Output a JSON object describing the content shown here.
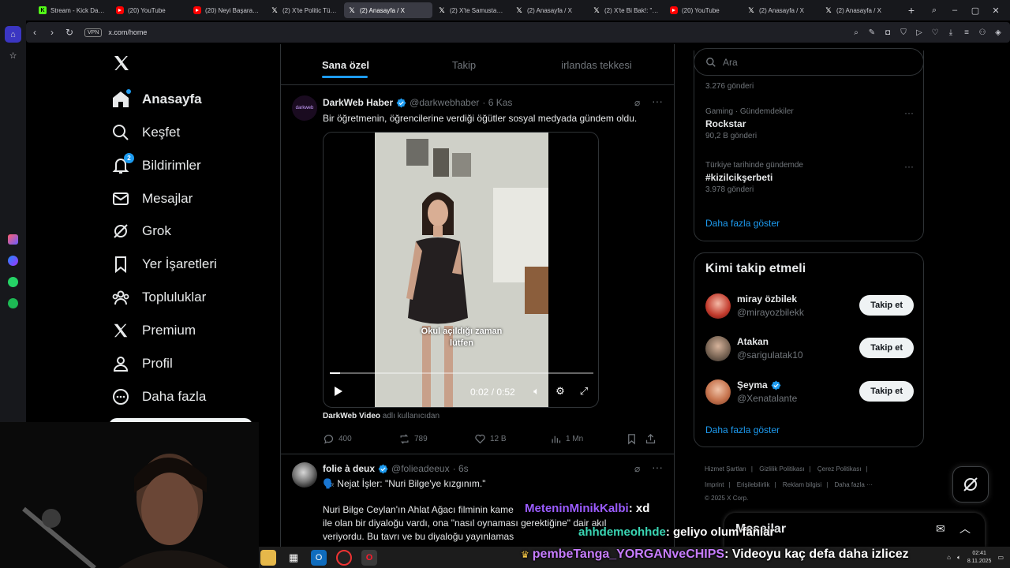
{
  "browser": {
    "tabs": [
      {
        "label": "Stream - Kick Dashboard",
        "icon": "kick"
      },
      {
        "label": "(20) YouTube",
        "icon": "youtube"
      },
      {
        "label": "(20) Neyi Başaramadın",
        "icon": "youtube"
      },
      {
        "label": "(2) X'te Politic Türk: \"#",
        "icon": "x"
      },
      {
        "label": "(2) Anasayfa / X",
        "icon": "x",
        "active": true
      },
      {
        "label": "(2) X'te Samustappen",
        "icon": "x"
      },
      {
        "label": "(2) Anasayfa / X",
        "icon": "x"
      },
      {
        "label": "(2) X'te Bi Bak!: \"Bir ka",
        "icon": "x"
      },
      {
        "label": "(20) YouTube",
        "icon": "youtube"
      },
      {
        "label": "(2) Anasayfa / X",
        "icon": "x"
      },
      {
        "label": "(2) Anasayfa / X",
        "icon": "x"
      }
    ],
    "vpn_label": "VPN",
    "url": "x.com/home"
  },
  "nav": {
    "items": [
      {
        "label": "Anasayfa",
        "icon": "home-icon"
      },
      {
        "label": "Keşfet",
        "icon": "search-icon"
      },
      {
        "label": "Bildirimler",
        "icon": "bell-icon",
        "badge": "2"
      },
      {
        "label": "Mesajlar",
        "icon": "mail-icon"
      },
      {
        "label": "Grok",
        "icon": "grok-icon"
      },
      {
        "label": "Yer İşaretleri",
        "icon": "bookmark-icon"
      },
      {
        "label": "Topluluklar",
        "icon": "communities-icon"
      },
      {
        "label": "Premium",
        "icon": "x-premium-icon"
      },
      {
        "label": "Profil",
        "icon": "profile-icon"
      },
      {
        "label": "Daha fazla",
        "icon": "more-circle-icon"
      }
    ]
  },
  "feed": {
    "tabs": [
      "Sana özel",
      "Takip",
      "irlandas tekkesi"
    ],
    "active_tab": 0,
    "post1": {
      "name": "DarkWeb Haber",
      "handle": "@darkwebhaber",
      "time": "· 6 Kas",
      "avatar_text": "darkweb",
      "text": "Bir öğretmenin, öğrencilerine verdiği öğütler sosyal medyada gündem oldu.",
      "video_caption_1": "Okul açıldığı zaman",
      "video_caption_2": "lütfen",
      "video_time": "0:02 / 0:52",
      "video_progress": 0.04,
      "from_user": "DarkWeb Video",
      "from_suffix": "adlı kullanıcıdan",
      "replies": "400",
      "reposts": "789",
      "likes": "12 B",
      "views": "1 Mn"
    },
    "post2": {
      "name": "folie à deux",
      "handle": "@folieadeeux",
      "time": "· 6s",
      "line1": "🗣️ Nejat İşler: \"Nuri Bilge'ye kızgınım.\"",
      "line2": "Nuri Bilge Ceylan'ın Ahlat Ağacı filminin kame",
      "line3": "ile olan bir diyaloğu vardı, ona \"nasıl oynaması gerektiğine\" dair akıl",
      "line4": "veriyordu. Bu tavrı ve bu diyaloğu yayınlamas"
    }
  },
  "sidebar": {
    "search_placeholder": "Ara",
    "trends": [
      {
        "meta": "",
        "name": "",
        "count": "3.276 gönderi"
      },
      {
        "meta": "Gaming · Gündemdekiler",
        "name": "Rockstar",
        "count": "90,2 B gönderi"
      },
      {
        "meta": "Türkiye tarihinde gündemde",
        "name": "#kizilcikşerbeti",
        "count": "3.978 gönderi"
      }
    ],
    "trends_more": "Daha fazla göster",
    "who_title": "Kimi takip etmeli",
    "who": [
      {
        "name": "miray özbilek",
        "handle": "@mirayozbilekk",
        "verified": false
      },
      {
        "name": "Atakan",
        "handle": "@sarigulatak10",
        "verified": false
      },
      {
        "name": "Şeyma",
        "handle": "@Xenatalante",
        "verified": true
      }
    ],
    "follow_label": "Takip et",
    "who_more": "Daha fazla göster",
    "footer": [
      "Hizmet Şartları",
      "Gizlilik Politikası",
      "Çerez Politikası",
      "Imprint",
      "Erişilebilirlik",
      "Reklam bilgisi",
      "Daha fazla ···",
      "© 2025 X Corp."
    ],
    "messages_title": "Mesajlar"
  },
  "chat": [
    {
      "user": "MeteninMinikKalbi",
      "msg": ": xd",
      "color": "#9b5cff"
    },
    {
      "user": "ahhdemeohhde",
      "msg": ": geliyo olum fanlar",
      "color": "#3ad6b4"
    },
    {
      "user": "pembeTanga_YORGANveCHIPS",
      "msg": ": Videoyu kaç defa daha izlicez",
      "color": "#c77dff"
    }
  ],
  "taskbar": {
    "time": "02:41",
    "date": "8.11.2025"
  },
  "colors": {
    "accent": "#1d9bf0",
    "background": "#000000",
    "border": "#2f3336"
  }
}
